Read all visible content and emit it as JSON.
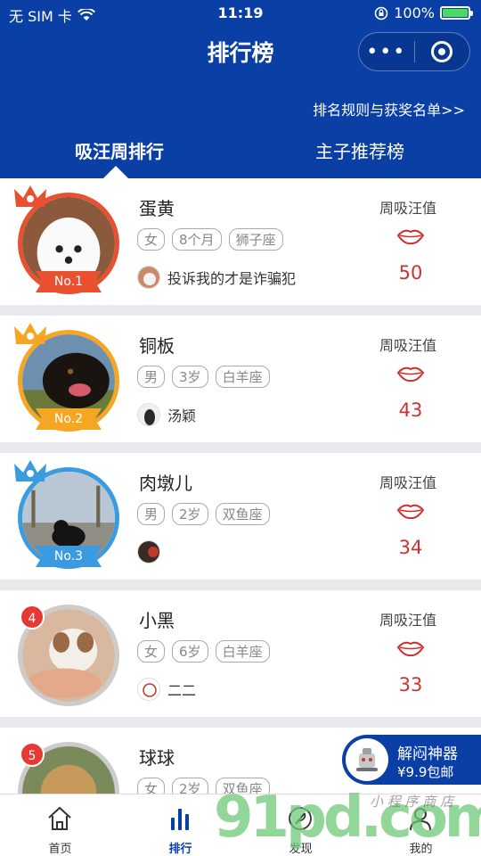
{
  "status_bar": {
    "carrier": "无 SIM 卡",
    "time": "11:19",
    "battery": "100%"
  },
  "nav": {
    "title": "排行榜",
    "more_glyph": "•••"
  },
  "rules_link": "排名规则与获奖名单>>",
  "tabs": [
    {
      "label": "吸汪周排行",
      "active": true
    },
    {
      "label": "主子推荐榜",
      "active": false
    }
  ],
  "score_label": "周吸汪值",
  "entries": [
    {
      "name": "蛋黄",
      "tags": [
        "女",
        "8个月",
        "狮子座"
      ],
      "owner": "投诉我的才是诈骗犯",
      "score": "50",
      "rank_label": "No.1",
      "color": "#e8502f"
    },
    {
      "name": "铜板",
      "tags": [
        "男",
        "3岁",
        "白羊座"
      ],
      "owner": "汤颖",
      "score": "43",
      "rank_label": "No.2",
      "color": "#f5a623"
    },
    {
      "name": "肉墩儿",
      "tags": [
        "男",
        "2岁",
        "双鱼座"
      ],
      "owner": "",
      "score": "34",
      "rank_label": "No.3",
      "color": "#3a9be0"
    },
    {
      "name": "小黑",
      "tags": [
        "女",
        "6岁",
        "白羊座"
      ],
      "owner": "二二",
      "score": "33",
      "rank_label": "4",
      "color": "#cccccc"
    },
    {
      "name": "球球",
      "tags": [
        "女",
        "2岁",
        "双鱼座"
      ],
      "owner": "",
      "score": "",
      "rank_label": "5",
      "color": "#cccccc"
    }
  ],
  "promo": {
    "title": "解闷神器",
    "subtitle": "¥9.9包邮"
  },
  "tabbar": [
    {
      "label": "首页",
      "icon": "home-icon"
    },
    {
      "label": "排行",
      "icon": "bar-chart-icon",
      "active": true
    },
    {
      "label": "发现",
      "icon": "feather-icon"
    },
    {
      "label": "我的",
      "icon": "user-icon"
    }
  ],
  "watermark": {
    "big": "91pd.com",
    "small": "小 程 序 商 店"
  }
}
